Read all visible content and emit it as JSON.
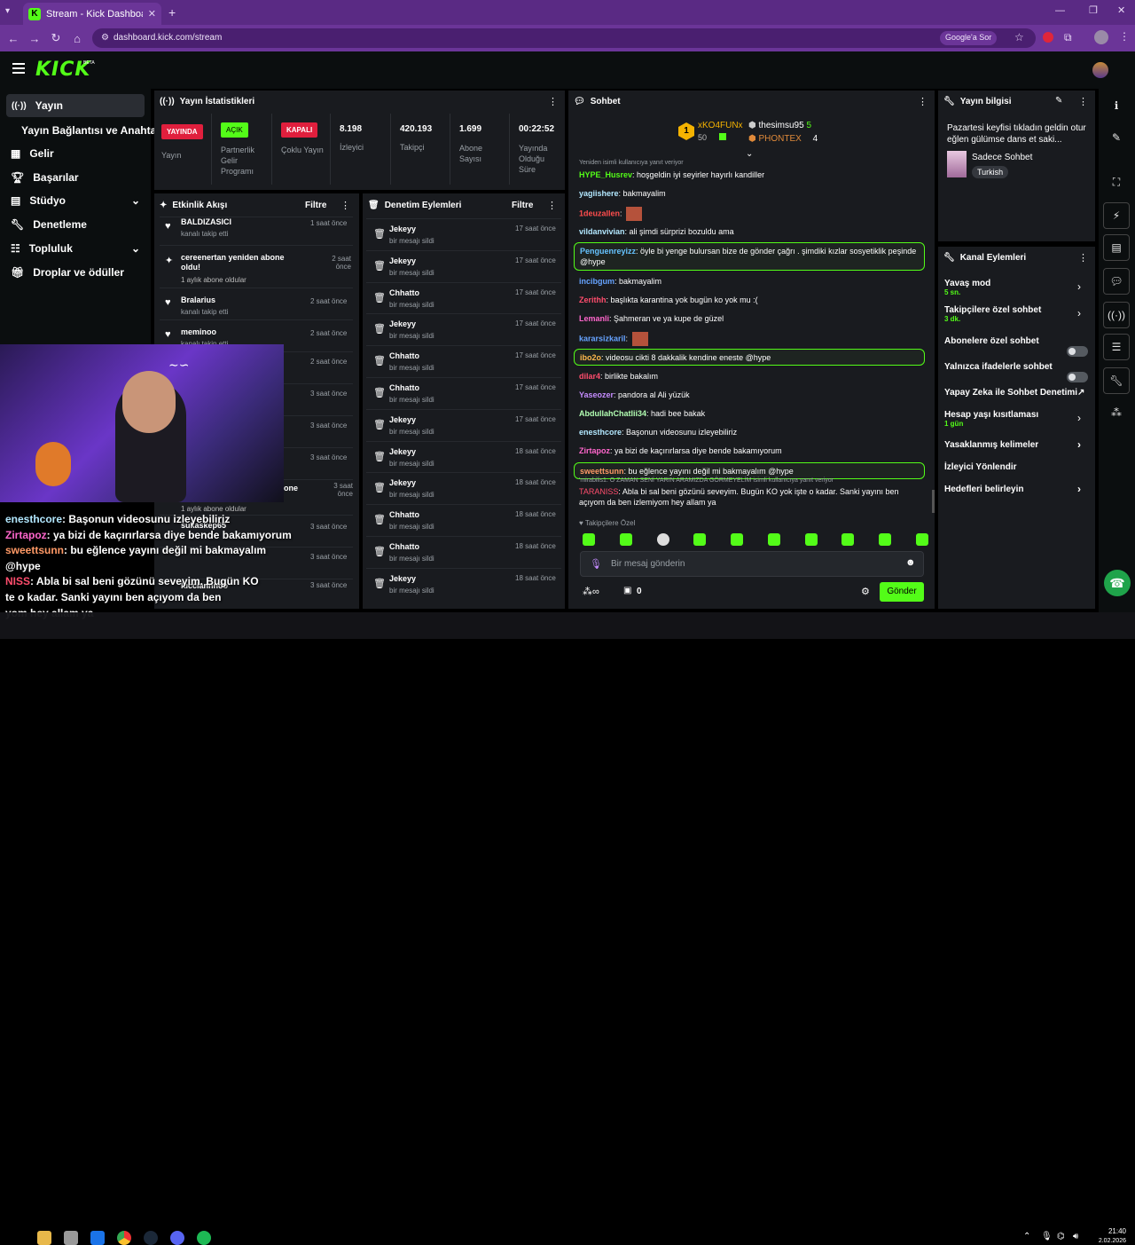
{
  "browser": {
    "tab_title": "Stream - Kick Dashboard",
    "url": "dashboard.kick.com/stream",
    "search_chip": "Google'a Sor"
  },
  "app": {
    "logo": "KICK",
    "logo_beta": "BETA"
  },
  "sidebar": {
    "items": [
      {
        "label": "Yayın"
      },
      {
        "label": "Yayın Bağlantısı ve Anahtarı"
      },
      {
        "label": "Gelir"
      },
      {
        "label": "Başarılar"
      },
      {
        "label": "Stüdyo"
      },
      {
        "label": "Denetleme"
      },
      {
        "label": "Topluluk"
      },
      {
        "label": "Droplar ve ödüller"
      }
    ]
  },
  "stats": {
    "title": "Yayın İstatistikleri",
    "yayinda_badge": "YAYINDA",
    "yayin_label": "Yayın",
    "acik_badge": "AÇIK",
    "partner_label": "Partnerlik Gelir Programı",
    "kapali_badge": "KAPALI",
    "coklu_label": "Çoklu Yayın",
    "viewers_value": "8.198",
    "viewers_label": "İzleyici",
    "followers_value": "420.193",
    "followers_label": "Takipçi",
    "subs_value": "1.699",
    "subs_label": "Abone Sayısı",
    "uptime_value": "00:22:52",
    "uptime_label": "Yayında Olduğu Süre"
  },
  "activity": {
    "title": "Etkinlik Akışı",
    "filter": "Filtre",
    "items": [
      {
        "name": "BALDIZASICI",
        "sub": "kanalı takip etti",
        "time": "1 saat önce"
      },
      {
        "name": "cereenertan yeniden abone oldu!",
        "sub": "1 aylık abone oldular",
        "time": "2 saat önce"
      },
      {
        "name": "Bralarius",
        "sub": "kanalı takip etti",
        "time": "2 saat önce"
      },
      {
        "name": "meminoo",
        "sub": "kanalı takip etti",
        "time": "2 saat önce"
      },
      {
        "name": "",
        "sub": "",
        "time": "2 saat önce"
      },
      {
        "name": "",
        "sub": "",
        "time": "3 saat önce"
      },
      {
        "name": "",
        "sub": "",
        "time": "3 saat önce"
      },
      {
        "name": "",
        "sub": "",
        "time": "3 saat önce"
      },
      {
        "name": "one",
        "sub": "1 aylık abone oldular",
        "time": "3 saat önce"
      },
      {
        "name": "sukaskep65",
        "sub": "",
        "time": "3 saat önce"
      },
      {
        "name": "",
        "sub": "",
        "time": "3 saat önce"
      },
      {
        "name": "",
        "sub": "",
        "time": "3 saat önce"
      },
      {
        "name": "lucciannnoo",
        "sub": "",
        "time": "3 saat önce"
      }
    ]
  },
  "moderation": {
    "title": "Denetim Eylemleri",
    "filter": "Filtre",
    "items": [
      {
        "name": "Jekeyy",
        "sub": "bir mesajı sildi",
        "time": "17 saat önce"
      },
      {
        "name": "Jekeyy",
        "sub": "bir mesajı sildi",
        "time": "17 saat önce"
      },
      {
        "name": "Chhatto",
        "sub": "bir mesajı sildi",
        "time": "17 saat önce"
      },
      {
        "name": "Jekeyy",
        "sub": "bir mesajı sildi",
        "time": "17 saat önce"
      },
      {
        "name": "Chhatto",
        "sub": "bir mesajı sildi",
        "time": "17 saat önce"
      },
      {
        "name": "Chhatto",
        "sub": "bir mesajı sildi",
        "time": "17 saat önce"
      },
      {
        "name": "Jekeyy",
        "sub": "bir mesajı sildi",
        "time": "17 saat önce"
      },
      {
        "name": "Jekeyy",
        "sub": "bir mesajı sildi",
        "time": "18 saat önce"
      },
      {
        "name": "Jekeyy",
        "sub": "bir mesajı sildi",
        "time": "18 saat önce"
      },
      {
        "name": "Chhatto",
        "sub": "bir mesajı sildi",
        "time": "18 saat önce"
      },
      {
        "name": "Chhatto",
        "sub": "bir mesajı sildi",
        "time": "18 saat önce"
      },
      {
        "name": "Jekeyy",
        "sub": "bir mesajı sildi",
        "time": "18 saat önce"
      }
    ]
  },
  "chat": {
    "title": "Sohbet",
    "top_gifter": {
      "name": "xKO4FUNx",
      "count": "50"
    },
    "gifter2": {
      "name": "thesimsu95",
      "count": "5"
    },
    "gifter3": {
      "name": "PHONTEX",
      "count": "4"
    },
    "reply_note_top": "Yeniden isimli kullanıcıya yanıt veriyor",
    "messages": [
      {
        "user": "HYPE_Husrev",
        "color": "#53fc18",
        "text": "hoşgeldin iyi seyirler hayırlı kandiller"
      },
      {
        "user": "yagiishere",
        "color": "#b3e8ff",
        "text": "bakmayalim"
      },
      {
        "user": "1deuzallen",
        "color": "#ff4d4d",
        "text": ""
      },
      {
        "user": "vildanvivian",
        "color": "#b3e8ff",
        "text": "ali şimdi sürprizi bozuldu ama"
      },
      {
        "user": "Penguenreyizz",
        "color": "#66c3ff",
        "text": "öyle bi yenge bulursan bize de gönder çağrı . şimdiki kızlar sosyetiklik peşinde @hype"
      },
      {
        "user": "incibgum",
        "color": "#66a3ff",
        "text": "bakmayalim"
      },
      {
        "user": "Zerithh",
        "color": "#ff4d6d",
        "text": "başlıkta karantina yok bugün ko yok mu :("
      },
      {
        "user": "Lemanli",
        "color": "#ff66cc",
        "text": "Şahmeran ve ya kupe de güzel"
      },
      {
        "user": "kararsizkaril",
        "color": "#66a3ff",
        "text": ""
      },
      {
        "user": "ibo2o",
        "color": "#ffb84d",
        "text": "videosu cikti 8 dakkalik kendine eneste @hype"
      },
      {
        "user": "dilar4",
        "color": "#ff4d6d",
        "text": "birlikte bakalım"
      },
      {
        "user": "Yaseozer",
        "color": "#c58cff",
        "text": "pandora al Ali yüzük"
      },
      {
        "user": "AbdullahChatlii34",
        "color": "#b3ffb3",
        "text": "hadi bee bakak"
      },
      {
        "user": "enesthcore",
        "color": "#b3e8ff",
        "text": "Başonun videosunu izleyebiliriz"
      },
      {
        "user": "Zirtapoz",
        "color": "#ff66cc",
        "text": "ya bizi de kaçırırlarsa diye bende bakamıyorum"
      },
      {
        "user": "sweettsunn",
        "color": "#ff9966",
        "text": "bu eğlence yayını değil mi bakmayalım @hype"
      }
    ],
    "reply_note": "'mirabilis1: O ZAMAN SENİ YARIN ARAMIZDA GÖRMEYELİM isimli kullanıcıya yanıt veriyor",
    "last_user": "TARANISS",
    "last_text": "Abla bi sal beni gözünü seveyim. Bugün KO yok işte o kadar. Sanki yayını ben açıyom da ben izlemiyom hey allam ya",
    "followers_only_label": "Takipçilere Özel",
    "input_placeholder": "Bir mesaj gönderin",
    "points_count": "0",
    "send_label": "Gönder"
  },
  "stream_info": {
    "title": "Yayın bilgisi",
    "stream_title": "Pazartesi keyfisi tıkladın geldin otur eğlen gülümse dans et saki...",
    "category": "Sadece Sohbet",
    "language": "Turkish"
  },
  "channel_actions": {
    "title": "Kanal Eylemleri",
    "items": [
      {
        "label": "Yavaş mod",
        "sub": "5 sn."
      },
      {
        "label": "Takipçilere özel sohbet",
        "sub": "3 dk."
      },
      {
        "label": "Abonelere özel sohbet",
        "sub": ""
      },
      {
        "label": "Yalnızca ifadelerle sohbet",
        "sub": ""
      },
      {
        "label": "Yapay Zeka ile Sohbet Denetimi",
        "sub": ""
      },
      {
        "label": "Hesap yaşı kısıtlaması",
        "sub": "1 gün"
      },
      {
        "label": "Yasaklanmış kelimeler",
        "sub": ""
      },
      {
        "label": "İzleyici Yönlendir",
        "sub": ""
      },
      {
        "label": "Hedefleri belirleyin",
        "sub": ""
      }
    ]
  },
  "overlay_chat": [
    {
      "user": "enesthcore",
      "text": ": Başonun videosunu izleyebiliriz"
    },
    {
      "user": "Zirtapoz",
      "text": ": ya bizi de kaçırırlarsa diye bende bakamıyorum"
    },
    {
      "user": "sweettsunn",
      "text": ": bu eğlence yayını değil mi bakmayalım"
    },
    {
      "user": "",
      "text": "@hype"
    },
    {
      "user": "NISS",
      "text": ": Abla bi sal beni gözünü seveyim. Bugün KO"
    },
    {
      "user": "",
      "text": "te o kadar. Sanki yayını ben açıyom da ben"
    },
    {
      "user": "",
      "text": "yom hey allam ya"
    }
  ],
  "taskbar": {
    "time": "21:40",
    "date": "2.02.2026"
  },
  "colors": {
    "accent": "#53fc18",
    "panel": "#191b1f",
    "live_red": "#e01f3d",
    "browser_purple": "#5a2a84"
  }
}
